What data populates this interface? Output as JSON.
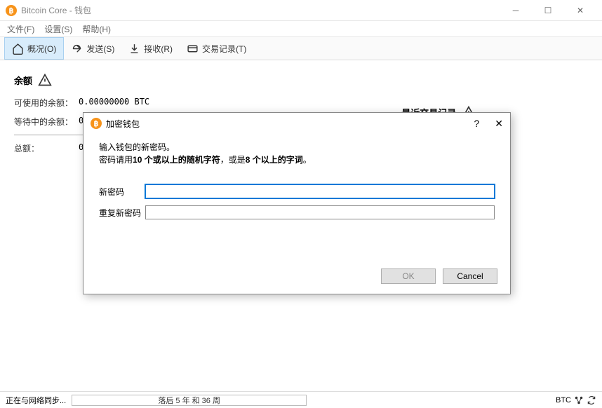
{
  "window": {
    "title": "Bitcoin Core - 钱包"
  },
  "menu": {
    "file": "文件(F)",
    "settings": "设置(S)",
    "help": "帮助(H)"
  },
  "tabs": {
    "overview": "概况(O)",
    "send": "发送(S)",
    "receive": "接收(R)",
    "transactions": "交易记录(T)"
  },
  "overview": {
    "balance_heading": "余额",
    "recent_heading": "最近交易记录",
    "available_label": "可使用的余额：",
    "available_value": "0.00000000 BTC",
    "pending_label": "等待中的余额：",
    "pending_value": "0.",
    "total_label": "总额：",
    "total_value": "0."
  },
  "dialog": {
    "title": "加密钱包",
    "msg_line1": "输入钱包的新密码。",
    "msg_line2_pre": "密码请用",
    "msg_line2_b1": "10 个或以上的随机字符",
    "msg_line2_mid": "，或是",
    "msg_line2_b2": "8 个以上的字词",
    "msg_line2_post": "。",
    "new_pass_label": "新密码",
    "repeat_pass_label": "重复新密码",
    "ok": "OK",
    "cancel": "Cancel",
    "help_symbol": "?",
    "close_symbol": "✕"
  },
  "status": {
    "syncing": "正在与网络同步...",
    "progress_text": "落后 5 年 和 36 周",
    "unit": "BTC"
  }
}
